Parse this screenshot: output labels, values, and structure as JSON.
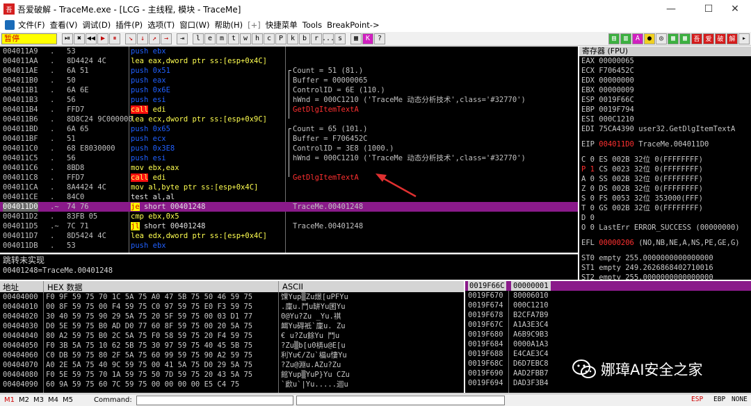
{
  "window": {
    "title": "吾爱破解 - TraceMe.exe - [LCG - 主线程, 模块 - TraceMe]",
    "app_icon_text": "吾",
    "controls": [
      "—",
      "☐",
      "✕"
    ]
  },
  "menu": [
    "文件(F)",
    "查看(V)",
    "调试(D)",
    "插件(P)",
    "选项(T)",
    "窗口(W)",
    "帮助(H)",
    "[+]",
    "快捷菜单",
    "Tools",
    "BreakPoint->"
  ],
  "toolbar": {
    "status": "暂停",
    "buttons_left": [
      "⏯",
      "✖",
      "◀◀",
      "▶",
      "⏸",
      "↘",
      "↓",
      "↗",
      "→",
      "⇥"
    ],
    "letter_buttons": [
      "l",
      "e",
      "m",
      "t",
      "w",
      "h",
      "c",
      "P",
      "k",
      "b",
      "r",
      "...",
      "s"
    ],
    "right_buttons": [
      "▦",
      "K",
      "?"
    ],
    "color_buttons": [
      "▤",
      "▥",
      "A",
      "●",
      "◎",
      "▦",
      "▦",
      "吾",
      "爱",
      "破",
      "解",
      "▸"
    ]
  },
  "disasm": {
    "rows": [
      {
        "addr": "004011A9",
        "dot": ".",
        "hex": "53",
        "op": "push",
        "args": "ebx",
        "kind": "push"
      },
      {
        "addr": "004011AA",
        "dot": ".",
        "hex": "8D4424 4C",
        "op": "lea",
        "args": "eax,dword ptr ss:[esp+0x4C]",
        "kind": "mov"
      },
      {
        "addr": "004011AE",
        "dot": ".",
        "hex": "6A 51",
        "op": "push",
        "args": "0x51",
        "kind": "push"
      },
      {
        "addr": "004011B0",
        "dot": ".",
        "hex": "50",
        "op": "push",
        "args": "eax",
        "kind": "push"
      },
      {
        "addr": "004011B1",
        "dot": ".",
        "hex": "6A 6E",
        "op": "push",
        "args": "0x6E",
        "kind": "push"
      },
      {
        "addr": "004011B3",
        "dot": ".",
        "hex": "56",
        "op": "push",
        "args": "esi",
        "kind": "push"
      },
      {
        "addr": "004011B4",
        "dot": ".",
        "hex": "FFD7",
        "op": "call",
        "args": "edi",
        "kind": "call"
      },
      {
        "addr": "004011B6",
        "dot": ".",
        "hex": "8D8C24 9C000000",
        "op": "lea",
        "args": "ecx,dword ptr ss:[esp+0x9C]",
        "kind": "mov"
      },
      {
        "addr": "004011BD",
        "dot": ".",
        "hex": "6A 65",
        "op": "push",
        "args": "0x65",
        "kind": "push"
      },
      {
        "addr": "004011BF",
        "dot": ".",
        "hex": "51",
        "op": "push",
        "args": "ecx",
        "kind": "push"
      },
      {
        "addr": "004011C0",
        "dot": ".",
        "hex": "68 E8030000",
        "op": "push",
        "args": "0x3E8",
        "kind": "push"
      },
      {
        "addr": "004011C5",
        "dot": ".",
        "hex": "56",
        "op": "push",
        "args": "esi",
        "kind": "push"
      },
      {
        "addr": "004011C6",
        "dot": ".",
        "hex": "8BD8",
        "op": "mov",
        "args": "ebx,eax",
        "kind": "mov"
      },
      {
        "addr": "004011C8",
        "dot": ".",
        "hex": "FFD7",
        "op": "call",
        "args": "edi",
        "kind": "call"
      },
      {
        "addr": "004011CA",
        "dot": ".",
        "hex": "8A4424 4C",
        "op": "mov",
        "args": "al,byte ptr ss:[esp+0x4C]",
        "kind": "mov"
      },
      {
        "addr": "004011CE",
        "dot": ".",
        "hex": "84C0",
        "op": "test",
        "args": "al,al",
        "kind": "text"
      },
      {
        "addr": "004011D0",
        "dot": ".~",
        "hex": "74 76",
        "op": "je",
        "args": "short 00401248",
        "kind": "jcc"
      },
      {
        "addr": "004011D2",
        "dot": ".",
        "hex": "83FB 05",
        "op": "cmp",
        "args": "ebx,0x5",
        "kind": "mov"
      },
      {
        "addr": "004011D5",
        "dot": ".~",
        "hex": "7C 71",
        "op": "jl",
        "args": "short 00401248",
        "kind": "jcc"
      },
      {
        "addr": "004011D7",
        "dot": ".",
        "hex": "8D5424 4C",
        "op": "lea",
        "args": "edx,dword ptr ss:[esp+0x4C]",
        "kind": "mov"
      },
      {
        "addr": "004011DB",
        "dot": ".",
        "hex": "53",
        "op": "push",
        "args": "ebx",
        "kind": "push"
      }
    ],
    "comments": [
      {
        "row": 2,
        "text": "Count = 51 (81.)",
        "red": false
      },
      {
        "row": 3,
        "text": "Buffer = 00000065",
        "red": false
      },
      {
        "row": 4,
        "text": "ControlID = 6E (110.)",
        "red": false
      },
      {
        "row": 5,
        "text": "hWnd = 000C1210 ('TraceMe 动态分析技术',class='#32770')",
        "red": false
      },
      {
        "row": 6,
        "text": "GetDlgItemTextA",
        "red": true
      },
      {
        "row": 8,
        "text": "Count = 65 (101.)",
        "red": false
      },
      {
        "row": 9,
        "text": "Buffer = F706452C",
        "red": false
      },
      {
        "row": 10,
        "text": "ControlID = 3E8 (1000.)",
        "red": false
      },
      {
        "row": 11,
        "text": "hWnd = 000C1210 ('TraceMe 动态分析技术',class='#32770')",
        "red": false
      },
      {
        "row": 13,
        "text": "GetDlgItemTextA",
        "red": true
      },
      {
        "row": 16,
        "text": "TraceMe.00401248",
        "red": false
      },
      {
        "row": 18,
        "text": "TraceMe.00401248",
        "red": false
      }
    ],
    "selected_row": 16
  },
  "info": {
    "line1": "跳转未实现",
    "line2": "00401248=TraceMe.00401248"
  },
  "registers": {
    "header": "寄存器 (FPU)",
    "gp": [
      {
        "name": "EAX",
        "value": "00000065",
        "extra": ""
      },
      {
        "name": "ECX",
        "value": "F706452C",
        "extra": ""
      },
      {
        "name": "EDX",
        "value": "00000000",
        "extra": ""
      },
      {
        "name": "EBX",
        "value": "00000009",
        "extra": ""
      },
      {
        "name": "ESP",
        "value": "0019F66C",
        "extra": ""
      },
      {
        "name": "EBP",
        "value": "0019F794",
        "extra": ""
      },
      {
        "name": "ESI",
        "value": "000C1210",
        "extra": ""
      },
      {
        "name": "EDI",
        "value": "75CA4390",
        "extra": "user32.GetDlgItemTextA"
      }
    ],
    "eip": {
      "name": "EIP",
      "value": "004011D0",
      "extra": "TraceMe.004011D0"
    },
    "flags": [
      {
        "flag": "C",
        "bit": "0",
        "seg": "ES",
        "sel": "002B",
        "bits": "32位",
        "range": "0(FFFFFFFF)",
        "red": false
      },
      {
        "flag": "P",
        "bit": "1",
        "seg": "CS",
        "sel": "0023",
        "bits": "32位",
        "range": "0(FFFFFFFF)",
        "red": true
      },
      {
        "flag": "A",
        "bit": "0",
        "seg": "SS",
        "sel": "002B",
        "bits": "32位",
        "range": "0(FFFFFFFF)",
        "red": false
      },
      {
        "flag": "Z",
        "bit": "0",
        "seg": "DS",
        "sel": "002B",
        "bits": "32位",
        "range": "0(FFFFFFFF)",
        "red": false
      },
      {
        "flag": "S",
        "bit": "0",
        "seg": "FS",
        "sel": "0053",
        "bits": "32位",
        "range": "353000(FFF)",
        "red": false
      },
      {
        "flag": "T",
        "bit": "0",
        "seg": "GS",
        "sel": "002B",
        "bits": "32位",
        "range": "0(FFFFFFFF)",
        "red": false
      }
    ],
    "d_flag": "D  0",
    "o_flag": "O  0",
    "lasterr": "LastErr ERROR_SUCCESS (00000000)",
    "efl_label": "EFL",
    "efl_value": "00000206",
    "efl_text": "(NO,NB,NE,A,NS,PE,GE,G)",
    "fpu": [
      "ST0 empty 255.0000000000000000",
      "ST1 empty 249.2626868402710016",
      "ST2 empty 255.0000000000000000"
    ]
  },
  "dump": {
    "headers": {
      "addr": "地址",
      "hex": "HEX 数据",
      "ascii": "ASCII"
    },
    "rows": [
      {
        "addr": "00404000",
        "hex": "F0 9F 59 75 70 1C 5A 75 A0 47 5B 75 50 46 59 75",
        "ascii": "馃Yup▒Zu燝[uPFYu"
      },
      {
        "addr": "00404010",
        "hex": "00 8F 59 75 00 F4 59 75 C0 97 59 75 E0 F3 59 75",
        "ascii": ".廩u.鬥u缾Yu囷Yu"
      },
      {
        "addr": "00404020",
        "hex": "30 40 59 75 90 29 5A 75 20 5F 59 75 00 03 D1 77",
        "ascii": "0@Yu?Zu _Yu.褀"
      },
      {
        "addr": "00404030",
        "hex": "D0 5E 59 75 B0 AD D0 77 60 8F 59 75 00 20 5A 75",
        "ascii": "衈Yu碍袛`廩u. Zu"
      },
      {
        "addr": "00404040",
        "hex": "80 A2 59 75 B0 2C 5A 75 F0 58 59 75 20 F4 59 75",
        "ascii": "€   u?Zu餘Yu 鬥u"
      },
      {
        "addr": "00404050",
        "hex": "F0 3B 5A 75 10 62 5B 75 30 97 59 75 40 45 5B 75",
        "ascii": "?Zu▒b[u0梇u@E[u"
      },
      {
        "addr": "00404060",
        "hex": "C0 DB 59 75 80 2F 5A 75 60 99 59 75 90 A2 59 75",
        "ascii": "利Yu€/Zu`橸u悽Yu"
      },
      {
        "addr": "00404070",
        "hex": "A0 2E 5A 75 40 9C 59 75 00 41 5A 75 D0 29 5A 75",
        "ascii": "?Zu@淵u.AZu?Zu"
      },
      {
        "addr": "00404080",
        "hex": "F0 5E 59 75 70 1A 59 75 50 7D 59 75 20 43 5A 75",
        "ascii": "館Yup▒YuP}Yu CZu"
      },
      {
        "addr": "00404090",
        "hex": "60 9A 59 75 60 7C 59 75 00 00 00 00 E5 C4 75",
        "ascii": "`歋u`|Yu.....迴u"
      }
    ]
  },
  "stack": {
    "rows": [
      {
        "addr": "0019F66C",
        "value": "00000001"
      },
      {
        "addr": "0019F670",
        "value": "80006010"
      },
      {
        "addr": "0019F674",
        "value": "000C1210"
      },
      {
        "addr": "0019F678",
        "value": "B2CFA7B9"
      },
      {
        "addr": "0019F67C",
        "value": "A1A3E3C4"
      },
      {
        "addr": "0019F680",
        "value": "A6B9C9B3"
      },
      {
        "addr": "0019F684",
        "value": "0000A1A3"
      },
      {
        "addr": "0019F688",
        "value": "E4CAE3C4"
      },
      {
        "addr": "0019F68C",
        "value": "D6D7EBC8"
      },
      {
        "addr": "0019F690",
        "value": "AAD2FBB7"
      },
      {
        "addr": "0019F694",
        "value": "DAD3F3B4"
      }
    ]
  },
  "statusbar": {
    "modes": [
      "M1",
      "M2",
      "M3",
      "M4",
      "M5"
    ],
    "command_label": "Command:",
    "right": [
      "ESP",
      "EBP",
      "NONE"
    ]
  },
  "watermark": "娜璋AI安全之家",
  "colors": {
    "background": "#000000",
    "selection": "#8a1a8a",
    "push": "#2060ff",
    "mov": "#ffff50",
    "call_bg": "#ff1010",
    "comment_red": "#ff3030",
    "arrow": "#e03030"
  }
}
